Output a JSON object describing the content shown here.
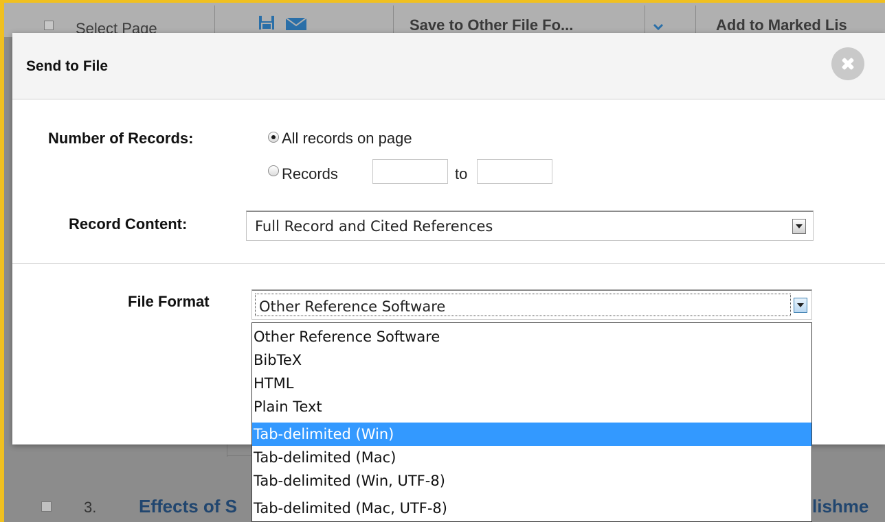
{
  "toolbar": {
    "select_page_label": "Select Page",
    "save_to_other_label": "Save to Other File Fo...",
    "add_to_marked_label": "Add to Marked Lis"
  },
  "background_row": {
    "number": "3.",
    "title_start": "Effects of S",
    "title_tail": "lishme"
  },
  "modal": {
    "title": "Send to File",
    "number_of_records_label": "Number of Records:",
    "radio_all_label": "All records on page",
    "radio_range_label": "Records",
    "range_to_label": "to",
    "range_from_value": "",
    "range_to_value": "",
    "record_content_label": "Record Content:",
    "record_content_value": "Full Record and Cited References",
    "file_format_label": "File Format",
    "file_format_value": "Other Reference Software",
    "file_format_options": [
      "Other Reference Software",
      "BibTeX",
      "HTML",
      "Plain Text",
      "Tab-delimited (Win)",
      "Tab-delimited (Mac)",
      "Tab-delimited (Win, UTF-8)",
      "Tab-delimited (Mac, UTF-8)"
    ],
    "highlighted_option": "Tab-delimited (Win)"
  },
  "colors": {
    "frame_accent": "#f0c020",
    "highlight": "#3399ff",
    "link_title": "#21466f"
  },
  "icons": [
    "save-icon",
    "email-icon",
    "chevron-down-icon",
    "close-icon",
    "dropdown-arrow-icon"
  ]
}
